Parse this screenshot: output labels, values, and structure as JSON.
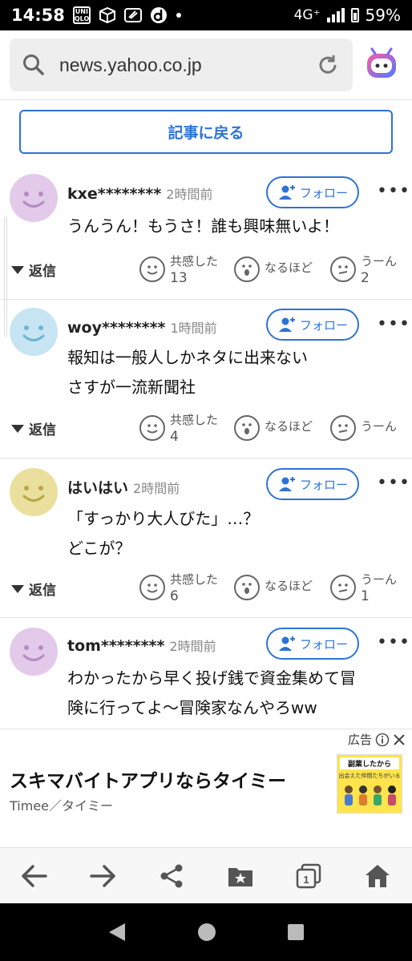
{
  "status_bar": {
    "time": "14:58",
    "app_icon_text": "UNI QLO",
    "network": "4G⁺",
    "battery": "59%"
  },
  "browser": {
    "url": "news.yahoo.co.jp"
  },
  "back_button": {
    "label": "記事に戻る"
  },
  "follow_label": "フォロー",
  "reply_label": "返信",
  "reactions": {
    "empathy": "共感した",
    "naruhodo": "なるほど",
    "uun": "うーん"
  },
  "comments": [
    {
      "user": "kxe********",
      "time": "2時間前",
      "text": [
        "うんうん！もうさ！誰も興味無いよ！"
      ],
      "empathy_count": "13",
      "uun_count": "2",
      "avatar_color": "#e3c9ea"
    },
    {
      "user": "woy********",
      "time": "1時間前",
      "text": [
        "報知は一般人しかネタに出来ない",
        "さすが一流新聞社"
      ],
      "empathy_count": "4",
      "uun_count": "",
      "avatar_color": "#c6e4f2"
    },
    {
      "user": "はいはい",
      "time": "2時間前",
      "text": [
        "「すっかり大人びた」…？",
        "どこが？"
      ],
      "empathy_count": "6",
      "uun_count": "1",
      "avatar_color": "#eadf9c"
    },
    {
      "user": "tom********",
      "time": "2時間前",
      "text": [
        "わかったから早く投げ銭で資金集めて冒",
        "険に行ってよ〜冒険家なんやろww"
      ],
      "avatar_color": "#e3c9ea"
    }
  ],
  "ad": {
    "tag": "広告",
    "title": "スキマバイトアプリならタイミー",
    "source": "Timee／タイミー",
    "image_banner": "副業したから",
    "image_sub": "出会えた仲間たちがいる"
  },
  "colors": {
    "accent": "#2d73d6",
    "text": "#222222",
    "muted": "#888888"
  }
}
